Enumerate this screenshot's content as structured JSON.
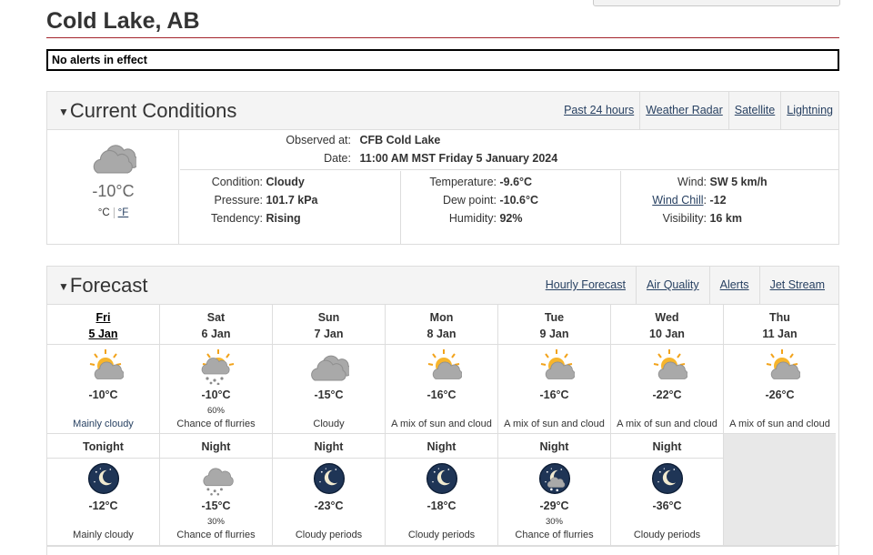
{
  "location": "Cold Lake, AB",
  "alert": "No alerts in effect",
  "current": {
    "title": "Current Conditions",
    "links": [
      "Past 24 hours",
      "Weather Radar",
      "Satellite",
      "Lightning"
    ],
    "temp": "-10°C",
    "unit_c": "°C",
    "unit_f": "°F",
    "icon": "cloudy-icon",
    "observed_label": "Observed at:",
    "observed_value": "CFB Cold Lake",
    "date_label": "Date:",
    "date_value": "11:00 AM MST Friday 5 January 2024",
    "condition_label": "Condition:",
    "condition_value": "Cloudy",
    "pressure_label": "Pressure:",
    "pressure_value": "101.7 kPa",
    "tendency_label": "Tendency:",
    "tendency_value": "Rising",
    "temperature_label": "Temperature:",
    "temperature_value": "-9.6°C",
    "dewpoint_label": "Dew point:",
    "dewpoint_value": "-10.6°C",
    "humidity_label": "Humidity:",
    "humidity_value": "92%",
    "wind_label": "Wind:",
    "wind_value": "SW 5 km/h",
    "windchill_label": "Wind Chill",
    "windchill_colon": ":",
    "windchill_value": "-12",
    "visibility_label": "Visibility:",
    "visibility_value": "16 km"
  },
  "forecast": {
    "title": "Forecast",
    "links": [
      "Hourly Forecast",
      "Air Quality",
      "Alerts",
      "Jet Stream"
    ],
    "days": [
      {
        "day": "Fri",
        "date": "5 Jan",
        "temp": "-10°C",
        "pop": "",
        "summary": "Mainly cloudy",
        "icon": "sun-cloud-icon"
      },
      {
        "day": "Sat",
        "date": "6 Jan",
        "temp": "-10°C",
        "pop": "60%",
        "summary": "Chance of flurries",
        "icon": "sun-flurries-icon"
      },
      {
        "day": "Sun",
        "date": "7 Jan",
        "temp": "-15°C",
        "pop": "",
        "summary": "Cloudy",
        "icon": "cloudy-icon"
      },
      {
        "day": "Mon",
        "date": "8 Jan",
        "temp": "-16°C",
        "pop": "",
        "summary": "A mix of sun and cloud",
        "icon": "sun-cloud-icon"
      },
      {
        "day": "Tue",
        "date": "9 Jan",
        "temp": "-16°C",
        "pop": "",
        "summary": "A mix of sun and cloud",
        "icon": "sun-cloud-icon"
      },
      {
        "day": "Wed",
        "date": "10 Jan",
        "temp": "-22°C",
        "pop": "",
        "summary": "A mix of sun and cloud",
        "icon": "sun-cloud-icon"
      },
      {
        "day": "Thu",
        "date": "11 Jan",
        "temp": "-26°C",
        "pop": "",
        "summary": "A mix of sun and cloud",
        "icon": "sun-cloud-icon"
      }
    ],
    "nights": [
      {
        "label": "Tonight",
        "temp": "-12°C",
        "pop": "",
        "summary": "Mainly cloudy",
        "icon": "moon-cloud-icon"
      },
      {
        "label": "Night",
        "temp": "-15°C",
        "pop": "30%",
        "summary": "Chance of flurries",
        "icon": "cloud-flurries-icon"
      },
      {
        "label": "Night",
        "temp": "-23°C",
        "pop": "",
        "summary": "Cloudy periods",
        "icon": "moon-cloud-icon"
      },
      {
        "label": "Night",
        "temp": "-18°C",
        "pop": "",
        "summary": "Cloudy periods",
        "icon": "moon-cloud-icon"
      },
      {
        "label": "Night",
        "temp": "-29°C",
        "pop": "30%",
        "summary": "Chance of flurries",
        "icon": "moon-flurries-icon"
      },
      {
        "label": "Night",
        "temp": "-36°C",
        "pop": "",
        "summary": "Cloudy periods",
        "icon": "moon-cloud-icon"
      }
    ]
  }
}
